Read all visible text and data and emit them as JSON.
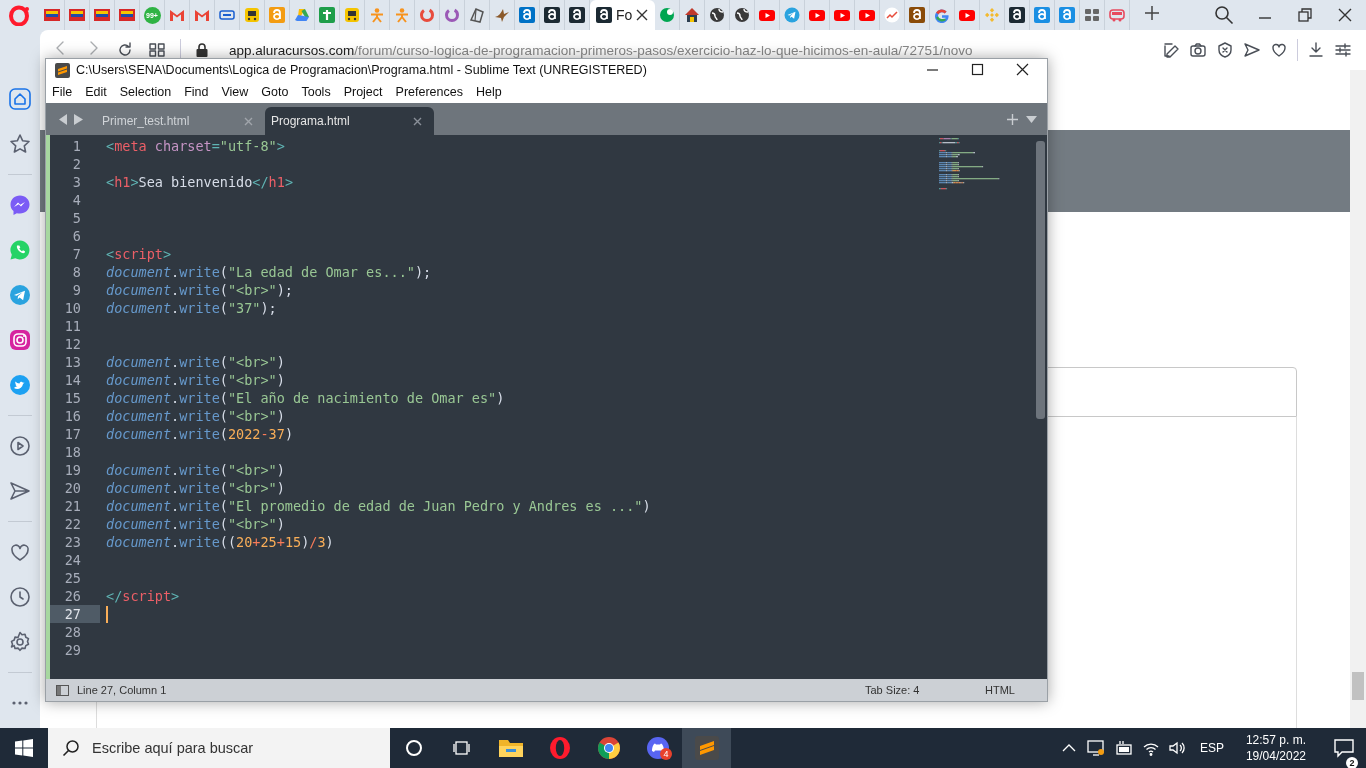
{
  "browser": {
    "tabs": [
      {
        "kind": "flag",
        "color": "#d62828",
        "selected": false
      },
      {
        "kind": "flag",
        "color": "#d62828",
        "selected": false
      },
      {
        "kind": "flag",
        "color": "#d62828",
        "selected": false
      },
      {
        "kind": "flag",
        "color": "#d62828",
        "selected": false
      },
      {
        "kind": "badge",
        "color": "#2fb344",
        "badge": "99+",
        "selected": false
      },
      {
        "kind": "mail",
        "color": "#ea4335",
        "selected": false
      },
      {
        "kind": "mail",
        "color": "#ea4335",
        "selected": false
      },
      {
        "kind": "chip",
        "color": "#1a5fd0",
        "selected": false
      },
      {
        "kind": "bus",
        "color": "#f5c400",
        "selected": false
      },
      {
        "kind": "tile",
        "color": "#f39c12",
        "selected": false
      },
      {
        "kind": "drive",
        "color": "#4285f4",
        "selected": false
      },
      {
        "kind": "cross",
        "color": "#1e9e4a",
        "selected": false
      },
      {
        "kind": "bus",
        "color": "#f5c400",
        "selected": false
      },
      {
        "kind": "person",
        "color": "#f7931e",
        "selected": false
      },
      {
        "kind": "person",
        "color": "#f7931e",
        "selected": false
      },
      {
        "kind": "ring",
        "color": "#e84c3d",
        "selected": false
      },
      {
        "kind": "ring",
        "color": "#9b59b6",
        "selected": false
      },
      {
        "kind": "book",
        "color": "#555555",
        "selected": false
      },
      {
        "kind": "bird",
        "color": "#8b5a2b",
        "selected": false
      },
      {
        "kind": "tile",
        "color": "#0072c6",
        "selected": false
      },
      {
        "kind": "tile",
        "color": "#1c2a33",
        "selected": false
      },
      {
        "kind": "tile",
        "color": "#1c2a33",
        "selected": false
      },
      {
        "kind": "tile",
        "color": "#1c2a33",
        "selected": true,
        "label": "Fo"
      },
      {
        "kind": "circle",
        "color": "#00a651",
        "selected": false
      },
      {
        "kind": "house",
        "color": "#c0392b",
        "selected": false
      },
      {
        "kind": "globe",
        "color": "#3a3a3a",
        "selected": false
      },
      {
        "kind": "globe",
        "color": "#3a3a3a",
        "selected": false
      },
      {
        "kind": "video",
        "color": "#ff0000",
        "selected": false
      },
      {
        "kind": "telegram",
        "color": "#2aa3df",
        "selected": false
      },
      {
        "kind": "video",
        "color": "#ff0000",
        "selected": false
      },
      {
        "kind": "video",
        "color": "#ff0000",
        "selected": false
      },
      {
        "kind": "video",
        "color": "#ff0000",
        "selected": false
      },
      {
        "kind": "chart",
        "color": "#ffffff",
        "selected": false
      },
      {
        "kind": "tile",
        "color": "#8a4b08",
        "selected": false
      },
      {
        "kind": "google",
        "color": "#4285f4",
        "selected": false
      },
      {
        "kind": "video",
        "color": "#ff0000",
        "selected": false
      },
      {
        "kind": "diamond",
        "color": "#f3ba2f",
        "selected": false
      },
      {
        "kind": "tile",
        "color": "#1c2a33",
        "selected": false
      },
      {
        "kind": "tile",
        "color": "#1a8fe3",
        "selected": false
      },
      {
        "kind": "tile",
        "color": "#1a8fe3",
        "selected": false
      },
      {
        "kind": "grid",
        "color": "#666666",
        "selected": false
      },
      {
        "kind": "van",
        "color": "#e84a5f",
        "selected": false
      }
    ],
    "address_bar": {
      "host": "app.aluracursos.com",
      "path": "/forum/curso-logica-de-programacion-primeros-pasos/exercicio-haz-lo-que-hicimos-en-aula/72751/novo"
    },
    "sidebar": {
      "groups": [
        [
          {
            "kind": "home",
            "selected": true
          },
          {
            "kind": "star",
            "selected": false
          }
        ],
        [
          {
            "kind": "messenger",
            "selected": false
          },
          {
            "kind": "whatsapp",
            "selected": false
          },
          {
            "kind": "telegram",
            "selected": false
          },
          {
            "kind": "instagram",
            "selected": false
          },
          {
            "kind": "twitter",
            "selected": false
          }
        ],
        [
          {
            "kind": "player",
            "selected": false
          },
          {
            "kind": "send",
            "selected": false
          }
        ],
        [
          {
            "kind": "heart",
            "selected": false
          },
          {
            "kind": "clock",
            "selected": false
          },
          {
            "kind": "gear",
            "selected": false
          }
        ],
        [
          {
            "kind": "more",
            "selected": false
          }
        ]
      ]
    }
  },
  "editor": {
    "title": "C:\\Users\\SENA\\Documents\\Logica de Programacion\\Programa.html - Sublime Text (UNREGISTERED)",
    "menu": [
      "File",
      "Edit",
      "Selection",
      "Find",
      "View",
      "Goto",
      "Tools",
      "Project",
      "Preferences",
      "Help"
    ],
    "tabs": [
      {
        "label": "Primer_test.html",
        "selected": false
      },
      {
        "label": "Programa.html",
        "selected": true
      }
    ],
    "lines": [
      {
        "number": "1",
        "current": false,
        "tokens": [
          {
            "kind": "punct",
            "text": "<"
          },
          {
            "kind": "tag",
            "text": "meta"
          },
          {
            "kind": "attr",
            "text": " charset"
          },
          {
            "kind": "punct",
            "text": "="
          },
          {
            "kind": "string",
            "text": "\"utf-8\""
          },
          {
            "kind": "punct",
            "text": ">"
          }
        ]
      },
      {
        "number": "2",
        "current": false
      },
      {
        "number": "3",
        "current": false,
        "tokens": [
          {
            "kind": "punct",
            "text": "<"
          },
          {
            "kind": "tag",
            "text": "h1"
          },
          {
            "kind": "punct",
            "text": ">"
          },
          {
            "kind": "plain",
            "text": "Sea bienvenido"
          },
          {
            "kind": "punct",
            "text": "</"
          },
          {
            "kind": "tag",
            "text": "h1"
          },
          {
            "kind": "punct",
            "text": ">"
          }
        ]
      },
      {
        "number": "4",
        "current": false
      },
      {
        "number": "5",
        "current": false
      },
      {
        "number": "6",
        "current": false
      },
      {
        "number": "7",
        "current": false,
        "tokens": [
          {
            "kind": "punct",
            "text": "<"
          },
          {
            "kind": "tag",
            "text": "script"
          },
          {
            "kind": "punct",
            "text": ">"
          }
        ]
      },
      {
        "number": "8",
        "current": false,
        "tokens": [
          {
            "kind": "object",
            "text": "document"
          },
          {
            "kind": "plain",
            "text": "."
          },
          {
            "kind": "method",
            "text": "write"
          },
          {
            "kind": "plain",
            "text": "("
          },
          {
            "kind": "string",
            "text": "\"La edad de Omar es...\""
          },
          {
            "kind": "plain",
            "text": ");"
          }
        ]
      },
      {
        "number": "9",
        "current": false,
        "tokens": [
          {
            "kind": "object",
            "text": "document"
          },
          {
            "kind": "plain",
            "text": "."
          },
          {
            "kind": "method",
            "text": "write"
          },
          {
            "kind": "plain",
            "text": "("
          },
          {
            "kind": "string",
            "text": "\"<br>\""
          },
          {
            "kind": "plain",
            "text": ");"
          }
        ]
      },
      {
        "number": "10",
        "current": false,
        "tokens": [
          {
            "kind": "object",
            "text": "document"
          },
          {
            "kind": "plain",
            "text": "."
          },
          {
            "kind": "method",
            "text": "write"
          },
          {
            "kind": "plain",
            "text": "("
          },
          {
            "kind": "string",
            "text": "\"37\""
          },
          {
            "kind": "plain",
            "text": ");"
          }
        ]
      },
      {
        "number": "11",
        "current": false
      },
      {
        "number": "12",
        "current": false
      },
      {
        "number": "13",
        "current": false,
        "tokens": [
          {
            "kind": "object",
            "text": "document"
          },
          {
            "kind": "plain",
            "text": "."
          },
          {
            "kind": "method",
            "text": "write"
          },
          {
            "kind": "plain",
            "text": "("
          },
          {
            "kind": "string",
            "text": "\"<br>\""
          },
          {
            "kind": "plain",
            "text": ")"
          }
        ]
      },
      {
        "number": "14",
        "current": false,
        "tokens": [
          {
            "kind": "object",
            "text": "document"
          },
          {
            "kind": "plain",
            "text": "."
          },
          {
            "kind": "method",
            "text": "write"
          },
          {
            "kind": "plain",
            "text": "("
          },
          {
            "kind": "string",
            "text": "\"<br>\""
          },
          {
            "kind": "plain",
            "text": ")"
          }
        ]
      },
      {
        "number": "15",
        "current": false,
        "tokens": [
          {
            "kind": "object",
            "text": "document"
          },
          {
            "kind": "plain",
            "text": "."
          },
          {
            "kind": "method",
            "text": "write"
          },
          {
            "kind": "plain",
            "text": "("
          },
          {
            "kind": "string",
            "text": "\"El año de nacimiento de Omar es\""
          },
          {
            "kind": "plain",
            "text": ")"
          }
        ]
      },
      {
        "number": "16",
        "current": false,
        "tokens": [
          {
            "kind": "object",
            "text": "document"
          },
          {
            "kind": "plain",
            "text": "."
          },
          {
            "kind": "method",
            "text": "write"
          },
          {
            "kind": "plain",
            "text": "("
          },
          {
            "kind": "string",
            "text": "\"<br>\""
          },
          {
            "kind": "plain",
            "text": ")"
          }
        ]
      },
      {
        "number": "17",
        "current": false,
        "tokens": [
          {
            "kind": "object",
            "text": "document"
          },
          {
            "kind": "plain",
            "text": "."
          },
          {
            "kind": "method",
            "text": "write"
          },
          {
            "kind": "plain",
            "text": "("
          },
          {
            "kind": "number",
            "text": "2022"
          },
          {
            "kind": "operator",
            "text": "-"
          },
          {
            "kind": "number",
            "text": "37"
          },
          {
            "kind": "plain",
            "text": ")"
          }
        ]
      },
      {
        "number": "18",
        "current": false
      },
      {
        "number": "19",
        "current": false,
        "tokens": [
          {
            "kind": "object",
            "text": "document"
          },
          {
            "kind": "plain",
            "text": "."
          },
          {
            "kind": "method",
            "text": "write"
          },
          {
            "kind": "plain",
            "text": "("
          },
          {
            "kind": "string",
            "text": "\"<br>\""
          },
          {
            "kind": "plain",
            "text": ")"
          }
        ]
      },
      {
        "number": "20",
        "current": false,
        "tokens": [
          {
            "kind": "object",
            "text": "document"
          },
          {
            "kind": "plain",
            "text": "."
          },
          {
            "kind": "method",
            "text": "write"
          },
          {
            "kind": "plain",
            "text": "("
          },
          {
            "kind": "string",
            "text": "\"<br>\""
          },
          {
            "kind": "plain",
            "text": ")"
          }
        ]
      },
      {
        "number": "21",
        "current": false,
        "tokens": [
          {
            "kind": "object",
            "text": "document"
          },
          {
            "kind": "plain",
            "text": "."
          },
          {
            "kind": "method",
            "text": "write"
          },
          {
            "kind": "plain",
            "text": "("
          },
          {
            "kind": "string",
            "text": "\"El promedio de edad de Juan Pedro y Andres es ...\""
          },
          {
            "kind": "plain",
            "text": ")"
          }
        ]
      },
      {
        "number": "22",
        "current": false,
        "tokens": [
          {
            "kind": "object",
            "text": "document"
          },
          {
            "kind": "plain",
            "text": "."
          },
          {
            "kind": "method",
            "text": "write"
          },
          {
            "kind": "plain",
            "text": "("
          },
          {
            "kind": "string",
            "text": "\"<br>\""
          },
          {
            "kind": "plain",
            "text": ")"
          }
        ]
      },
      {
        "number": "23",
        "current": false,
        "tokens": [
          {
            "kind": "object",
            "text": "document"
          },
          {
            "kind": "plain",
            "text": "."
          },
          {
            "kind": "method",
            "text": "write"
          },
          {
            "kind": "plain",
            "text": "(("
          },
          {
            "kind": "number",
            "text": "20"
          },
          {
            "kind": "operator",
            "text": "+"
          },
          {
            "kind": "number",
            "text": "25"
          },
          {
            "kind": "operator",
            "text": "+"
          },
          {
            "kind": "number",
            "text": "15"
          },
          {
            "kind": "plain",
            "text": ")"
          },
          {
            "kind": "operator",
            "text": "/"
          },
          {
            "kind": "number",
            "text": "3"
          },
          {
            "kind": "plain",
            "text": ")"
          }
        ]
      },
      {
        "number": "24",
        "current": false
      },
      {
        "number": "25",
        "current": false
      },
      {
        "number": "26",
        "current": false,
        "tokens": [
          {
            "kind": "punct",
            "text": "</"
          },
          {
            "kind": "tag",
            "text": "script"
          },
          {
            "kind": "punct",
            "text": ">"
          }
        ]
      },
      {
        "number": "27",
        "current": true
      },
      {
        "number": "28",
        "current": false
      },
      {
        "number": "29",
        "current": false
      }
    ],
    "status": {
      "position": "Line 27, Column 1",
      "tab_size": "Tab Size: 4",
      "syntax": "HTML"
    }
  },
  "taskbar": {
    "search": {
      "placeholder": "Escribe aquí para buscar"
    },
    "apps": [
      {
        "kind": "folder",
        "active": false
      },
      {
        "kind": "opera",
        "active": false
      },
      {
        "kind": "chrome",
        "active": false
      },
      {
        "kind": "discord",
        "active": false,
        "badge": "4"
      },
      {
        "kind": "sublime",
        "active": true
      }
    ],
    "tray": {
      "language": "ESP",
      "time": "12:57 p. m.",
      "date": "19/04/2022",
      "notifications": "2"
    }
  }
}
